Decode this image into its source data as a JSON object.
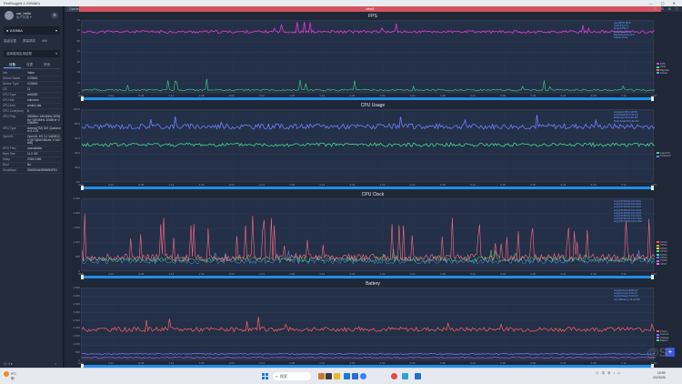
{
  "window": {
    "title": "PerfDog(v5.1.21B360)",
    "controls": "—  ▢  ✕"
  },
  "user": {
    "name": "cat_hello",
    "subtitle": "用户设置 ▾"
  },
  "device": {
    "name": "V2056A",
    "dropdown_icon": "chevron-down-icon"
  },
  "nav": {
    "items": [
      "高级设置",
      "屏幕录制",
      "Wifi"
    ]
  },
  "app_select": {
    "label": "选择被测应用进程",
    "dropdown_icon": "chevron-down-icon"
  },
  "side_tabs": [
    {
      "label": "设备"
    },
    {
      "label": "设置"
    },
    {
      "label": "其他"
    }
  ],
  "info": {
    "header": {
      "k": "Info",
      "v": "Value"
    },
    "rows": [
      {
        "k": "Device Name",
        "v": "V2056A"
      },
      {
        "k": "Device Type",
        "v": "V2056A"
      },
      {
        "k": "OS",
        "v": "11"
      },
      {
        "k": "CPU Type",
        "v": "sm6350"
      },
      {
        "k": "CPU Info",
        "v": "unknown"
      },
      {
        "k": "CPU Arch",
        "v": "arm64-v8a"
      },
      {
        "k": "CPU Core(num)",
        "v": "8"
      },
      {
        "k": "CPU Freq",
        "v": "300MHz~1804MHz 300MHz~1804MHz 300MHz~2208MHz"
      },
      {
        "k": "GPU Type",
        "v": "Adreno(TM) 619 Qualcomm 6.2.21"
      },
      {
        "k": "OpenGL",
        "v": "OpenGL ES 3.2 V@0512.0 (GIT@5b7d5c4e, I7d1f7cb0)"
      },
      {
        "k": "GPU Freq",
        "v": "unavailable"
      },
      {
        "k": "Ram Size",
        "v": "11.0 GB"
      },
      {
        "k": "Swap",
        "v": "2048.0 MB"
      },
      {
        "k": "Root",
        "v": "No"
      },
      {
        "k": "SerialNum",
        "v": "5048DN4N9SMBNFE4"
      }
    ]
  },
  "main_header": {
    "left": "OpenerTest",
    "center": "label1",
    "right": "⊡ ⊟ ⊞ ▢"
  },
  "x_ticks": [
    "0:00",
    "0:24",
    "0:48",
    "1:12",
    "1:36",
    "2:00",
    "2:24",
    "2:48",
    "3:12",
    "3:36",
    "4:00",
    "4:24",
    "4:48",
    "5:12",
    "5:36",
    "6:00",
    "6:24",
    "6:48",
    "7:12",
    "7:36"
  ],
  "panels": [
    {
      "title": "FPS",
      "y_ticks": [
        "70",
        "60",
        "50",
        "40",
        "30",
        "20",
        "10",
        "0"
      ],
      "legend": [
        "Avg(FPS):58.9",
        "Var(FPS):3.2",
        "Drop(FPS):0",
        "Jank(/10min):0",
        "BigJank(/10min):0",
        "Stutter:0.0%"
      ],
      "right_legend": [
        {
          "name": "FPS",
          "color": "#e23bd4"
        },
        {
          "name": "Jank",
          "color": "#3dd98a"
        },
        {
          "name": "BigJank",
          "color": "#ff6b3d"
        },
        {
          "name": "Stutter",
          "color": "#4aa3ff"
        }
      ]
    },
    {
      "title": "CPU Usage",
      "y_ticks": [
        "100%",
        "80%",
        "60%",
        "40%",
        "20%",
        "0%"
      ],
      "legend": [
        "Avg(AppCPU):18.5%",
        "Avg(TotalCPU):38.2%",
        "Max(AppCPU):25.8%",
        "Max(TotalCPU):52.4%"
      ],
      "right_legend": [
        {
          "name": "AppCPU",
          "color": "#3dd98a"
        },
        {
          "name": "TotalCPU",
          "color": "#6f7dff"
        }
      ]
    },
    {
      "title": "CPU Clock",
      "y_ticks": [
        "2,500",
        "2,000",
        "1,500",
        "1,000",
        "500",
        "0"
      ],
      "legend": [
        "Avg(CPU0Clk):912 MHz",
        "Avg(CPU1Clk):912 MHz",
        "Avg(CPU2Clk):912 MHz",
        "Avg(CPU3Clk):912 MHz",
        "Avg(CPU4Clk):912 MHz",
        "Avg(CPU5Clk):912 MHz",
        "Avg(CPU6Clk):1104 MHz",
        "Avg(CPU7Clk):1104 MHz"
      ],
      "right_legend": [
        {
          "name": "CPU0",
          "color": "#ff5e5e"
        },
        {
          "name": "CPU1",
          "color": "#ffa23d"
        },
        {
          "name": "CPU2",
          "color": "#ffe14a"
        },
        {
          "name": "CPU3",
          "color": "#54e36a"
        },
        {
          "name": "CPU4",
          "color": "#3dd9d9"
        },
        {
          "name": "CPU5",
          "color": "#4a8cff"
        },
        {
          "name": "CPU6",
          "color": "#b16bff"
        },
        {
          "name": "CPU7",
          "color": "#ff6bd2"
        }
      ]
    },
    {
      "title": "Battery",
      "y_ticks": [
        "4,500",
        "4,000",
        "3,500",
        "3,000",
        "2,500",
        "2,000",
        "1,500",
        "1,000",
        "500",
        "0"
      ],
      "legend": [
        "Avg(Power):2105mW",
        "Avg(Current):512mA",
        "Avg(Voltage):4112mV",
        "Sum(Battery):15.6mWh"
      ],
      "right_legend": [
        {
          "name": "Power",
          "color": "#ff5e5e"
        },
        {
          "name": "Current",
          "color": "#6f7dff"
        },
        {
          "name": "Voltage",
          "color": "#b16bff"
        },
        {
          "name": "Battery",
          "color": "#3dd98a"
        }
      ]
    }
  ],
  "colors": {
    "accent": "#1e8fe8",
    "fps": "#e23bd4",
    "jank": "#3dd98a",
    "cpu_total": "#6f7dff",
    "cpu_app": "#3dd98a",
    "clock": "#ff6b8a",
    "power": "#ff5e5e",
    "header_red": "#d4525e"
  },
  "bottom": {
    "left_label": "◎ 4 ▸",
    "collapse": "«"
  },
  "taskbar": {
    "weather_temp": "9°C",
    "weather_desc": "阴",
    "search": "搜索",
    "tray": "∧ 中 ⊕ ♪ ▭",
    "time": "15:59",
    "date": "2023/2/6"
  }
}
